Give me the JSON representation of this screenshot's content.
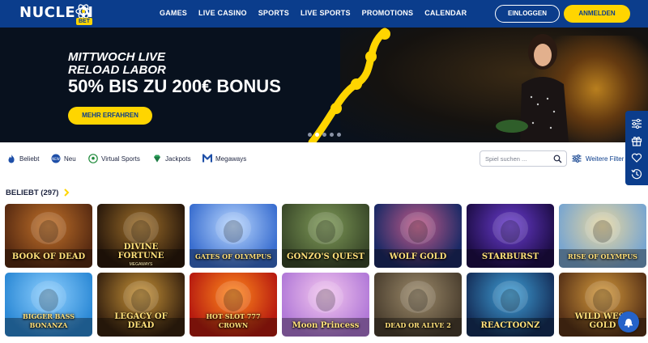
{
  "header": {
    "logo_text": "NUCLE N",
    "logo_badge": "BET",
    "nav": [
      "GAMES",
      "LIVE CASINO",
      "SPORTS",
      "LIVE SPORTS",
      "PROMOTIONS",
      "CALENDAR"
    ],
    "login_label": "EINLOGGEN",
    "register_label": "ANMELDEN"
  },
  "hero": {
    "line1": "MITTWOCH LIVE",
    "line2": "RELOAD LABOR",
    "bonus": "50% BIS ZU 200€ BONUS",
    "button_label": "MEHR ERFAHREN",
    "slide_count": 5,
    "active_slide": 1
  },
  "filters": {
    "items": [
      {
        "label": "Beliebt",
        "icon": "flame-icon"
      },
      {
        "label": "Neu",
        "icon": "new-badge-icon"
      },
      {
        "label": "Virtual Sports",
        "icon": "soccer-ball-icon"
      },
      {
        "label": "Jackpots",
        "icon": "diamond-icon"
      },
      {
        "label": "Megaways",
        "icon": "megaways-m-icon"
      }
    ],
    "search_placeholder": "Spiel suchen ...",
    "more_label": "Weitere Filter"
  },
  "section": {
    "title": "BELIEBT (297)"
  },
  "games": [
    {
      "name": "BOOK OF DEAD",
      "sub": "",
      "bg": "#5a2c12",
      "accent": "#c2722a"
    },
    {
      "name": "DIVINE FORTUNE",
      "sub": "MEGAWAYS",
      "bg": "#2b1a0c",
      "accent": "#a0702a"
    },
    {
      "name": "GATES OF OLYMPUS",
      "sub": "",
      "bg": "#3b6fd0",
      "accent": "#b9d7ff"
    },
    {
      "name": "GONZO'S QUEST",
      "sub": "",
      "bg": "#3b4a2a",
      "accent": "#7f9a58"
    },
    {
      "name": "WOLF GOLD",
      "sub": "",
      "bg": "#1c2a66",
      "accent": "#c25a88"
    },
    {
      "name": "STARBURST",
      "sub": "",
      "bg": "#1f0e4a",
      "accent": "#6a3cd0"
    },
    {
      "name": "RISE OF OLYMPUS",
      "sub": "",
      "bg": "#7aa6cf",
      "accent": "#e8d7a0"
    },
    {
      "name": "BIGGER BASS BONANZA",
      "sub": "",
      "bg": "#2d8ad6",
      "accent": "#8fd0ff"
    },
    {
      "name": "LEGACY OF DEAD",
      "sub": "",
      "bg": "#3a2410",
      "accent": "#c99438"
    },
    {
      "name": "HOT SLOT 777 CROWN",
      "sub": "",
      "bg": "#b81c10",
      "accent": "#ff8a1c"
    },
    {
      "name": "Moon Princess",
      "sub": "",
      "bg": "#b27ad8",
      "accent": "#f4c7ee"
    },
    {
      "name": "DEAD OR ALIVE 2",
      "sub": "",
      "bg": "#4c4030",
      "accent": "#9c8a6a"
    },
    {
      "name": "REACTOONZ",
      "sub": "",
      "bg": "#16315c",
      "accent": "#3fa0d8"
    },
    {
      "name": "WILD WEST GOLD",
      "sub": "",
      "bg": "#5a3418",
      "accent": "#d59a3c"
    }
  ],
  "colors": {
    "brand_blue": "#0b3d8c",
    "accent_yellow": "#ffd500"
  }
}
